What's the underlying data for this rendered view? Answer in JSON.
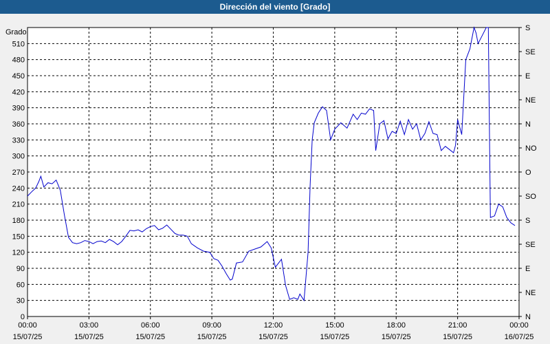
{
  "window": {
    "title": "Dirección del viento [Grado]"
  },
  "chart_data": {
    "type": "line",
    "title": "Dirección del viento [Grado]",
    "ylabel": "Grado",
    "ylim": [
      0,
      540
    ],
    "y_ticks": [
      0,
      30,
      60,
      90,
      120,
      150,
      180,
      210,
      240,
      270,
      300,
      330,
      360,
      390,
      420,
      450,
      480,
      510
    ],
    "right_ticks": [
      "N",
      "NE",
      "E",
      "SE",
      "S",
      "SO",
      "O",
      "NO",
      "N",
      "NE",
      "E",
      "SE",
      "S"
    ],
    "right_tick_values": [
      0,
      45,
      90,
      135,
      180,
      225,
      270,
      315,
      360,
      405,
      450,
      495,
      540
    ],
    "xlim_hours": [
      0,
      24
    ],
    "x_ticks": [
      {
        "hour": 0,
        "time": "00:00",
        "date": "15/07/25"
      },
      {
        "hour": 3,
        "time": "03:00",
        "date": "15/07/25"
      },
      {
        "hour": 6,
        "time": "06:00",
        "date": "15/07/25"
      },
      {
        "hour": 9,
        "time": "09:00",
        "date": "15/07/25"
      },
      {
        "hour": 12,
        "time": "12:00",
        "date": "15/07/25"
      },
      {
        "hour": 15,
        "time": "15:00",
        "date": "15/07/25"
      },
      {
        "hour": 18,
        "time": "18:00",
        "date": "15/07/25"
      },
      {
        "hour": 21,
        "time": "21:00",
        "date": "15/07/25"
      },
      {
        "hour": 24,
        "time": "00:00",
        "date": "16/07/25"
      }
    ],
    "grid": true,
    "series": [
      {
        "color": "#0000cc",
        "points": [
          [
            0.0,
            225
          ],
          [
            0.2,
            233
          ],
          [
            0.4,
            240
          ],
          [
            0.55,
            252
          ],
          [
            0.65,
            262
          ],
          [
            0.8,
            242
          ],
          [
            1.0,
            250
          ],
          [
            1.2,
            248
          ],
          [
            1.4,
            255
          ],
          [
            1.6,
            236
          ],
          [
            1.8,
            190
          ],
          [
            2.0,
            148
          ],
          [
            2.2,
            138
          ],
          [
            2.4,
            136
          ],
          [
            2.6,
            138
          ],
          [
            2.8,
            142
          ],
          [
            3.0,
            140
          ],
          [
            3.2,
            136
          ],
          [
            3.4,
            140
          ],
          [
            3.6,
            141
          ],
          [
            3.8,
            138
          ],
          [
            4.0,
            144
          ],
          [
            4.2,
            140
          ],
          [
            4.4,
            134
          ],
          [
            4.6,
            140
          ],
          [
            4.8,
            150
          ],
          [
            5.0,
            161
          ],
          [
            5.2,
            160
          ],
          [
            5.4,
            162
          ],
          [
            5.6,
            158
          ],
          [
            5.8,
            164
          ],
          [
            6.0,
            168
          ],
          [
            6.2,
            170
          ],
          [
            6.4,
            162
          ],
          [
            6.6,
            165
          ],
          [
            6.8,
            171
          ],
          [
            7.0,
            163
          ],
          [
            7.2,
            155
          ],
          [
            7.4,
            152
          ],
          [
            7.6,
            152
          ],
          [
            7.8,
            150
          ],
          [
            8.0,
            136
          ],
          [
            8.3,
            128
          ],
          [
            8.6,
            122
          ],
          [
            8.9,
            120
          ],
          [
            9.1,
            108
          ],
          [
            9.3,
            105
          ],
          [
            9.5,
            94
          ],
          [
            9.7,
            80
          ],
          [
            9.9,
            68
          ],
          [
            10.0,
            70
          ],
          [
            10.2,
            100
          ],
          [
            10.5,
            102
          ],
          [
            10.8,
            122
          ],
          [
            11.1,
            126
          ],
          [
            11.4,
            130
          ],
          [
            11.7,
            140
          ],
          [
            11.9,
            128
          ],
          [
            12.1,
            92
          ],
          [
            12.4,
            107
          ],
          [
            12.6,
            58
          ],
          [
            12.8,
            32
          ],
          [
            13.0,
            35
          ],
          [
            13.2,
            32
          ],
          [
            13.3,
            42
          ],
          [
            13.5,
            30
          ],
          [
            13.7,
            120
          ],
          [
            13.8,
            245
          ],
          [
            13.9,
            330
          ],
          [
            14.0,
            362
          ],
          [
            14.2,
            380
          ],
          [
            14.4,
            392
          ],
          [
            14.6,
            385
          ],
          [
            14.8,
            330
          ],
          [
            15.0,
            350
          ],
          [
            15.3,
            362
          ],
          [
            15.6,
            352
          ],
          [
            15.9,
            378
          ],
          [
            16.1,
            368
          ],
          [
            16.3,
            380
          ],
          [
            16.5,
            378
          ],
          [
            16.7,
            388
          ],
          [
            16.9,
            385
          ],
          [
            17.0,
            310
          ],
          [
            17.2,
            360
          ],
          [
            17.4,
            366
          ],
          [
            17.6,
            332
          ],
          [
            17.8,
            346
          ],
          [
            18.0,
            342
          ],
          [
            18.2,
            365
          ],
          [
            18.4,
            340
          ],
          [
            18.6,
            368
          ],
          [
            18.8,
            350
          ],
          [
            19.0,
            360
          ],
          [
            19.2,
            330
          ],
          [
            19.4,
            342
          ],
          [
            19.6,
            364
          ],
          [
            19.8,
            342
          ],
          [
            20.0,
            340
          ],
          [
            20.2,
            310
          ],
          [
            20.4,
            318
          ],
          [
            20.6,
            312
          ],
          [
            20.8,
            306
          ],
          [
            20.9,
            320
          ],
          [
            21.0,
            368
          ],
          [
            21.2,
            340
          ],
          [
            21.4,
            480
          ],
          [
            21.6,
            500
          ],
          [
            21.8,
            540
          ],
          [
            21.9,
            530
          ],
          [
            22.0,
            510
          ],
          [
            22.2,
            525
          ],
          [
            22.4,
            540
          ],
          [
            22.5,
            540
          ],
          [
            22.6,
            185
          ],
          [
            22.8,
            188
          ],
          [
            23.0,
            210
          ],
          [
            23.2,
            205
          ],
          [
            23.4,
            185
          ],
          [
            23.6,
            175
          ],
          [
            23.8,
            170
          ]
        ]
      }
    ]
  }
}
